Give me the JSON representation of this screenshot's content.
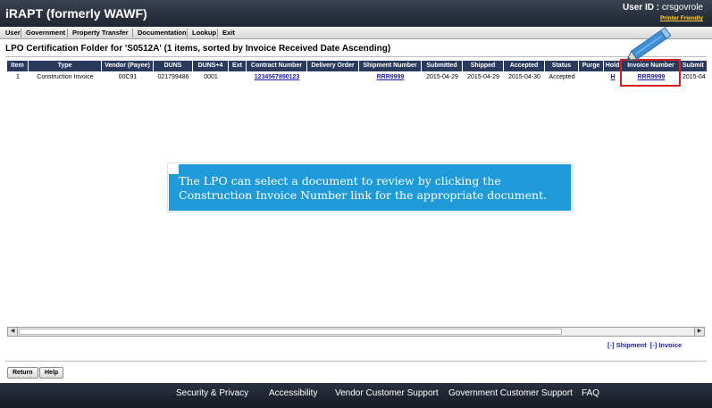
{
  "app": {
    "title": "iRAPT (formerly WAWF)",
    "user_id_label": "User ID :",
    "user_id_value": "crsgovrole",
    "printer_friendly": "Printer Friendly"
  },
  "menu": [
    "User",
    "Government",
    "Property Transfer",
    "Documentation",
    "Lookup",
    "Exit"
  ],
  "folder_title": "LPO Certification Folder for 'S0512A' (1 items, sorted by Invoice Received Date Ascending)",
  "table": {
    "headers": [
      "Item",
      "Type",
      "Vendor (Payee)",
      "DUNS",
      "DUNS+4",
      "Ext",
      "Contract Number",
      "Delivery Order",
      "Shipment Number",
      "Submitted",
      "Shipped",
      "Accepted",
      "Status",
      "Purge",
      "Hold",
      "Invoice Number",
      "Submit"
    ],
    "row": {
      "item": "1",
      "type": "Construction Invoice",
      "vendor": "00C91",
      "duns": "021799486",
      "duns4": "0001",
      "ext": "",
      "contract": "1234567890123",
      "delivery_order": "",
      "shipment": "RRR9999",
      "submitted": "2015-04-29",
      "shipped": "2015-04-29",
      "accepted": "2015-04-30",
      "status": "Accepted",
      "purge": "",
      "hold": "H",
      "invoice": "RRR9999",
      "submit_partial": "2015-04"
    }
  },
  "callout": "The LPO can select a document to review by clicking the Construction Invoice Number link for the appropriate document.",
  "toggles": {
    "shipment": "[-] Shipment",
    "invoice": "[-] Invoice"
  },
  "buttons": {
    "return": "Return",
    "help": "Help"
  },
  "footer": [
    "Security & Privacy",
    "Accessibility",
    "Vendor Customer Support",
    "Government Customer Support",
    "FAQ"
  ],
  "colors": {
    "header_bg": "#1f2530",
    "table_header": "#2a3a5c",
    "callout": "#1e9ad9",
    "highlight": "#d42020",
    "link": "#1a1aa8"
  }
}
